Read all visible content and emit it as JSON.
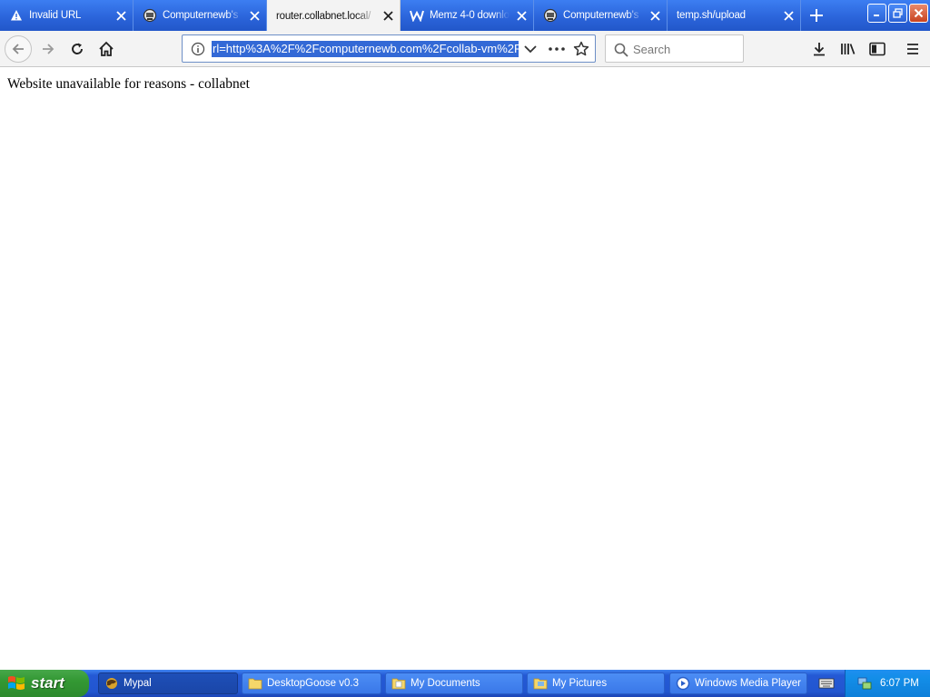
{
  "browser": {
    "tabs": [
      {
        "title": "Invalid URL",
        "icon": "warning-icon",
        "active": false
      },
      {
        "title": "Computernewb's",
        "icon": "computernewb-favicon",
        "active": false
      },
      {
        "title": "router.collabnet.local/",
        "icon": "",
        "active": true
      },
      {
        "title": "Memz 4-0 downlo",
        "icon": "wix-favicon",
        "active": false
      },
      {
        "title": "Computernewb's",
        "icon": "computernewb-favicon",
        "active": false
      },
      {
        "title": "temp.sh/upload",
        "icon": "",
        "active": false
      }
    ],
    "url": "rl=http%3A%2F%2Fcomputernewb.com%2Fcollab-vm%2F",
    "search_placeholder": "Search"
  },
  "page": {
    "message": "Website unavailable for reasons - collabnet"
  },
  "taskbar": {
    "start_label": "start",
    "tasks": [
      {
        "label": "Mypal",
        "icon": "mypal-icon",
        "active": true
      },
      {
        "label": "DesktopGoose v0.3",
        "icon": "folder-icon",
        "active": false
      },
      {
        "label": "My Documents",
        "icon": "folder-icon",
        "active": false
      },
      {
        "label": "My Pictures",
        "icon": "folder-icon",
        "active": false
      },
      {
        "label": "Windows Media Player",
        "icon": "media-player-icon",
        "active": false
      }
    ],
    "clock": "6:07 PM"
  },
  "colors": {
    "xp_blue": "#2459d5",
    "start_green": "#339833",
    "url_selection": "#3369d6"
  }
}
